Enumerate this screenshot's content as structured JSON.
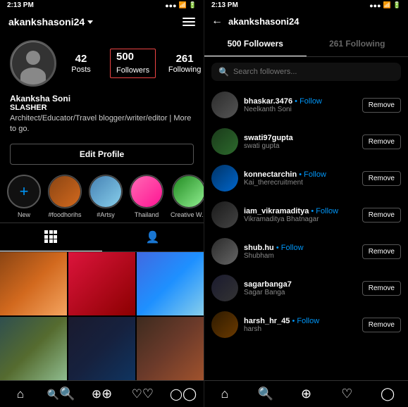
{
  "left": {
    "status_time": "2:13 PM",
    "status_icons": "●●● ◁ ⊘ ⊞ ⊟ ▮▮",
    "username": "akankshasoni24",
    "stats": {
      "posts": {
        "number": "42",
        "label": "Posts"
      },
      "followers": {
        "number": "500",
        "label": "Followers"
      },
      "following": {
        "number": "261",
        "label": "Following"
      }
    },
    "profile_name": "Akanksha Soni",
    "profile_role": "SLASHER",
    "profile_bio": "Architect/Educator/Travel blogger/writer/editor | More to go.",
    "edit_profile_label": "Edit Profile",
    "stories": [
      {
        "label": "New",
        "type": "new"
      },
      {
        "label": "#foodhorihs",
        "type": "thumb1"
      },
      {
        "label": "#Artsy",
        "type": "thumb2"
      },
      {
        "label": "Thailand",
        "type": "thumb3"
      },
      {
        "label": "Creative W...",
        "type": "thumb4"
      }
    ],
    "nav": [
      "home",
      "search",
      "add",
      "heart",
      "person"
    ]
  },
  "right": {
    "status_time": "2:13 PM",
    "status_icons": "●●● ◁ ⊘ ⊞ ⊟ ▮▮",
    "username": "akankshasoni24",
    "tabs": [
      {
        "label": "500 Followers",
        "active": true
      },
      {
        "label": "261 Following",
        "active": false
      }
    ],
    "search_placeholder": "Search followers...",
    "followers": [
      {
        "handle": "bhaskar.3476",
        "follow_suffix": " • Follow",
        "realname": "Neelkanth Soni",
        "remove": "Remove",
        "avatar_class": "fa-1"
      },
      {
        "handle": "swati97gupta",
        "follow_suffix": "",
        "realname": "swati gupta",
        "remove": "Remove",
        "avatar_class": "fa-2"
      },
      {
        "handle": "konnectarchin",
        "follow_suffix": " • Follow",
        "realname": "Kai_therecruitment",
        "remove": "Remove",
        "avatar_class": "fa-3"
      },
      {
        "handle": "iam_vikramaditya",
        "follow_suffix": " • Follow",
        "realname": "Vikramaditya Bhatnagar",
        "remove": "Remove",
        "avatar_class": "fa-4"
      },
      {
        "handle": "shub.hu",
        "follow_suffix": " • Follow",
        "realname": "Shubham",
        "remove": "Remove",
        "avatar_class": "fa-5"
      },
      {
        "handle": "sagarbanga7",
        "follow_suffix": "",
        "realname": "Sagar Banga",
        "remove": "Remove",
        "avatar_class": "fa-6"
      },
      {
        "handle": "harsh_hr_45",
        "follow_suffix": " • Follow",
        "realname": "harsh",
        "remove": "Remove",
        "avatar_class": "fa-7"
      }
    ],
    "nav": [
      "home",
      "search",
      "add",
      "heart",
      "person"
    ]
  }
}
